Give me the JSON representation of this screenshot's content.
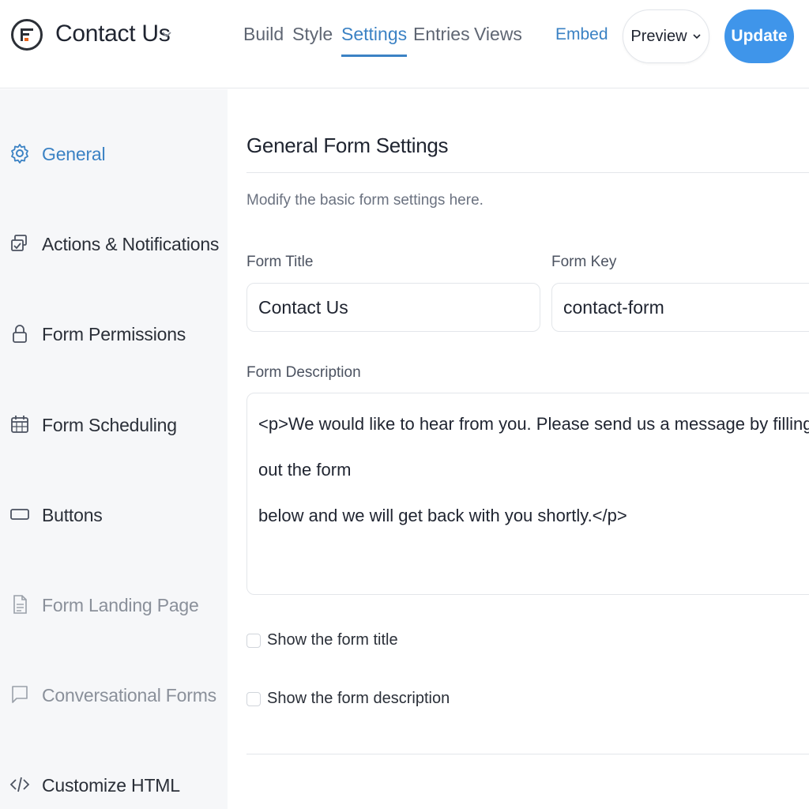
{
  "header": {
    "form_name": "Contact Us",
    "tabs": [
      {
        "label": "Build",
        "active": false
      },
      {
        "label": "Style",
        "active": false
      },
      {
        "label": "Settings",
        "active": true
      },
      {
        "label": "Entries",
        "active": false
      },
      {
        "label": "Views",
        "active": false
      }
    ],
    "embed_label": "Embed",
    "preview_label": "Preview",
    "update_label": "Update"
  },
  "sidebar": {
    "items": [
      {
        "label": "General",
        "icon": "gear-icon",
        "state": "active"
      },
      {
        "label": "Actions & Notifications",
        "icon": "notifications-icon",
        "state": "normal"
      },
      {
        "label": "Form Permissions",
        "icon": "lock-icon",
        "state": "normal"
      },
      {
        "label": "Form Scheduling",
        "icon": "calendar-icon",
        "state": "normal"
      },
      {
        "label": "Buttons",
        "icon": "button-icon",
        "state": "normal"
      },
      {
        "label": "Form Landing Page",
        "icon": "page-icon",
        "state": "muted"
      },
      {
        "label": "Conversational Forms",
        "icon": "chat-icon",
        "state": "muted"
      },
      {
        "label": "Customize HTML",
        "icon": "code-icon",
        "state": "normal"
      }
    ]
  },
  "main": {
    "title": "General Form Settings",
    "description": "Modify the basic form settings here.",
    "form_title_label": "Form Title",
    "form_title_value": "Contact Us",
    "form_key_label": "Form Key",
    "form_key_value": "contact-form",
    "form_description_label": "Form Description",
    "form_description_line1": "<p>We would like to hear from you. Please send us a message by filling out the form",
    "form_description_line2": "below and we will get back with you shortly.</p>",
    "show_title_label": "Show the form title",
    "show_title_checked": false,
    "show_description_label": "Show the form description",
    "show_description_checked": false
  },
  "colors": {
    "accent": "#3b82c4",
    "update_button": "#3f95ea",
    "sidebar_bg": "#f6f7f9"
  }
}
